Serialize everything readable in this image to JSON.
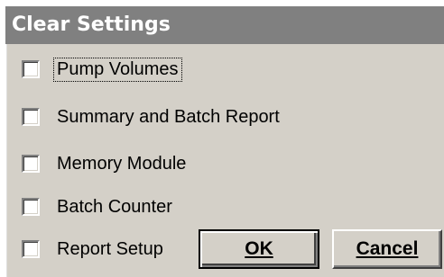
{
  "dialog": {
    "title": "Clear Settings"
  },
  "options": [
    {
      "label": "Pump Volumes",
      "checked": false,
      "focused": true
    },
    {
      "label": "Summary and Batch Report",
      "checked": false,
      "focused": false
    },
    {
      "label": "Memory Module",
      "checked": false,
      "focused": false
    },
    {
      "label": "Batch Counter",
      "checked": false,
      "focused": false
    },
    {
      "label": "Report Setup",
      "checked": false,
      "focused": false
    }
  ],
  "buttons": {
    "ok_label": "OK",
    "cancel_label": "Cancel"
  }
}
